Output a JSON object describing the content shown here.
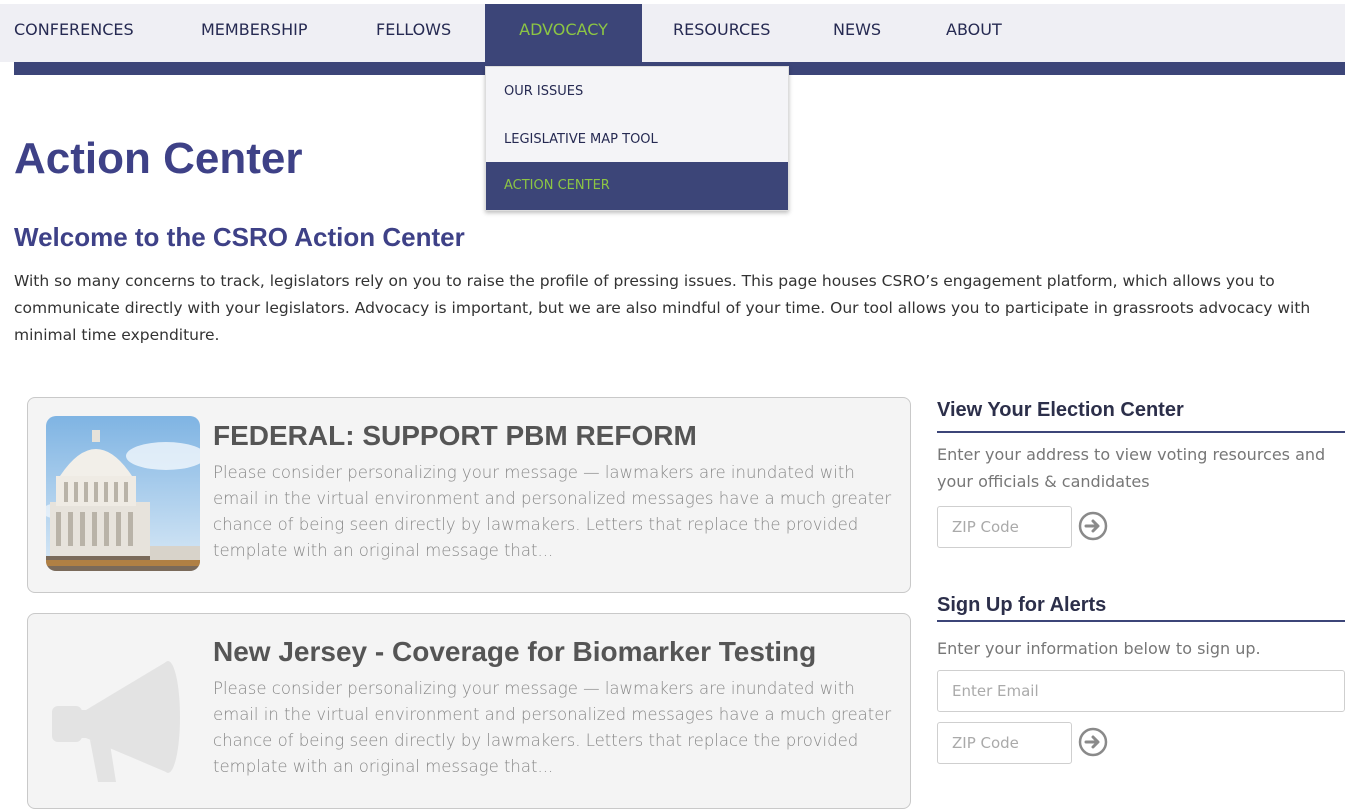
{
  "nav": {
    "items": [
      "CONFERENCES",
      "MEMBERSHIP",
      "FELLOWS",
      "ADVOCACY",
      "RESOURCES",
      "NEWS",
      "ABOUT"
    ],
    "active": "ADVOCACY",
    "dropdown": [
      "OUR ISSUES",
      "LEGISLATIVE MAP TOOL",
      "ACTION CENTER"
    ],
    "dropdown_active": "ACTION CENTER"
  },
  "page": {
    "title": "Action Center",
    "welcome": "Welcome to the CSRO Action Center",
    "intro": "With so many concerns to track, legislators rely on you to raise the profile of pressing issues. This page houses CSRO’s engagement platform, which allows you to communicate directly with your legislators. Advocacy is important, but we are also mindful of your time. Our tool allows you to participate in grassroots advocacy with minimal time expenditure."
  },
  "cards": [
    {
      "title": "FEDERAL: SUPPORT PBM REFORM",
      "body": "Please consider personalizing your message — lawmakers are inundated with email in the virtual environment and personalized messages have a much greater chance of being seen directly by lawmakers. Letters that replace the provided template with an original message that...",
      "thumb_icon": "capitol-building-image"
    },
    {
      "title": "New Jersey - Coverage for Biomarker Testing",
      "body": "Please consider personalizing your message — lawmakers are inundated with email in the virtual environment and personalized messages have a much greater chance of being seen directly by lawmakers. Letters that replace the provided template with an original message that...",
      "thumb_icon": "megaphone-icon"
    }
  ],
  "sidebar": {
    "election": {
      "heading": "View Your Election Center",
      "text": "Enter your address to view voting resources and your officials & candidates",
      "zip_placeholder": "ZIP Code"
    },
    "alerts": {
      "heading": "Sign Up for Alerts",
      "text": "Enter your information below to sign up.",
      "email_placeholder": "Enter Email",
      "zip_placeholder": "ZIP Code"
    }
  },
  "colors": {
    "brand_navy": "#3c4578",
    "brand_green": "#8cc544",
    "heading_purple": "#3e4187",
    "nav_bg": "#efeff4"
  }
}
